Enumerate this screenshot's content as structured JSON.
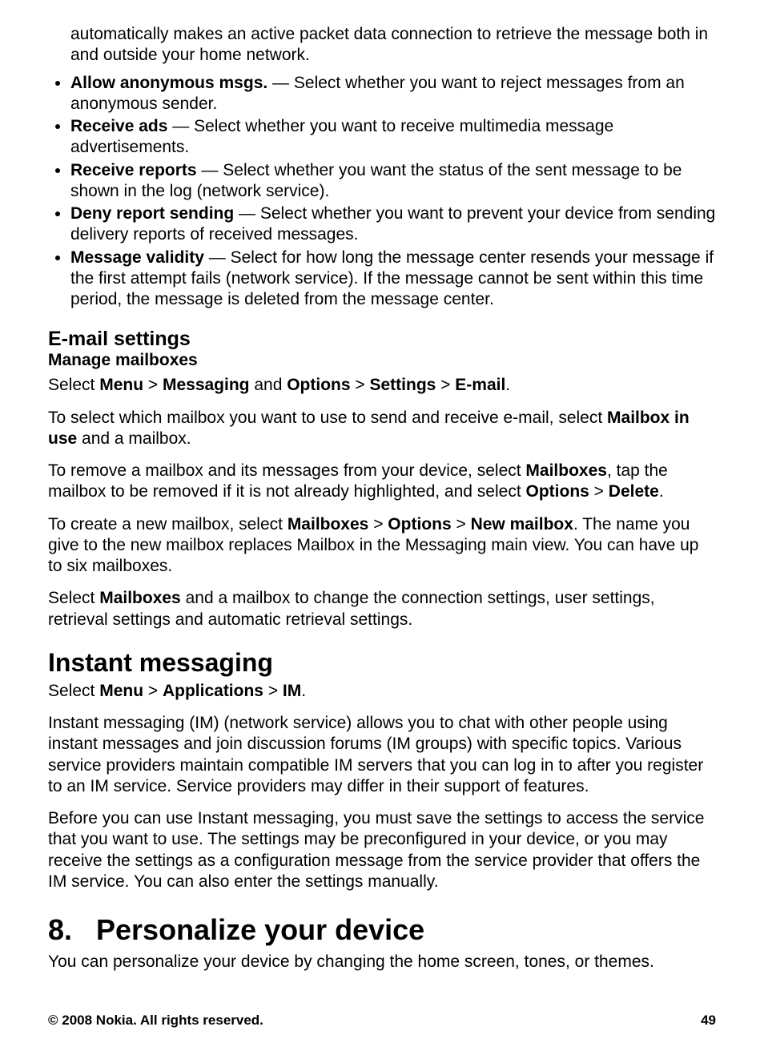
{
  "intro": "automatically makes an active packet data connection to retrieve the message both in and outside your home network.",
  "bullets": [
    {
      "bold": "Allow anonymous msgs.",
      "rest": "  — Select whether you want to reject messages from an anonymous sender."
    },
    {
      "bold": "Receive ads",
      "rest": "  — Select whether you want to receive multimedia message advertisements."
    },
    {
      "bold": "Receive reports",
      "rest": "  — Select whether you want the status of the sent message to be shown in the log (network service)."
    },
    {
      "bold": "Deny report sending",
      "rest": "  — Select whether you want to prevent your device from sending delivery reports of received messages."
    },
    {
      "bold": "Message validity",
      "rest": "  — Select for how long the message center resends your message if the first attempt fails (network service). If the message cannot be sent within this time period, the message is deleted from the message center."
    }
  ],
  "email_heading": "E-mail settings",
  "manage_heading": "Manage mailboxes",
  "nav1": {
    "pre": "Select ",
    "b1": "Menu",
    "s1": " > ",
    "b2": "Messaging",
    "mid": " and ",
    "b3": "Options",
    "s2": " > ",
    "b4": "Settings",
    "s3": " > ",
    "b5": "E-mail",
    "post": "."
  },
  "para1": {
    "pre": "To select which mailbox you want to use to send and receive e-mail, select ",
    "b1": "Mailbox in use",
    "post": " and a mailbox."
  },
  "para2": {
    "pre": "To remove a mailbox and its messages from your device, select ",
    "b1": "Mailboxes",
    "mid": ", tap the mailbox to be removed if it is not already highlighted, and select ",
    "b2": "Options",
    "s1": " > ",
    "b3": "Delete",
    "post": "."
  },
  "para3": {
    "pre": "To create a new mailbox, select ",
    "b1": "Mailboxes",
    "s1": " > ",
    "b2": "Options",
    "s2": " > ",
    "b3": "New mailbox",
    "post": ". The name you give to the new mailbox replaces Mailbox in the Messaging main view. You can have up to six mailboxes."
  },
  "para4": {
    "pre": "Select ",
    "b1": "Mailboxes",
    "post": " and a mailbox to change the connection settings, user settings, retrieval settings and automatic retrieval settings."
  },
  "im_heading": "Instant messaging",
  "nav2": {
    "pre": "Select ",
    "b1": "Menu",
    "s1": " > ",
    "b2": "Applications",
    "s2": " > ",
    "b3": "IM",
    "post": "."
  },
  "im_p1": "Instant messaging (IM) (network service) allows you to chat with other people using instant messages and join discussion forums (IM groups) with specific topics. Various service providers maintain compatible IM servers that you can log in to after you register to an IM service. Service providers may differ in their support of features.",
  "im_p2": "Before you can use Instant messaging, you must save the settings to access the service that you want to use. The settings may be preconfigured in your device, or you may receive the settings as a configuration message from the service provider that offers the IM service. You can also enter the settings manually.",
  "chapter_num": "8.",
  "chapter_title": "Personalize your device",
  "chapter_intro": "You can personalize your device by changing the home screen, tones, or themes.",
  "footer_left": "© 2008 Nokia. All rights reserved.",
  "footer_right": "49"
}
